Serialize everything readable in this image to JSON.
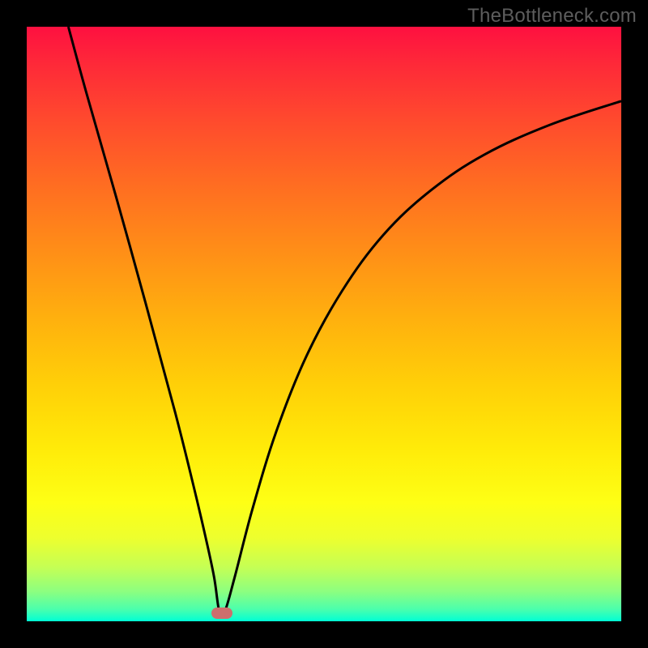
{
  "watermark": "TheBottleneck.com",
  "chart_data": {
    "type": "line",
    "title": "",
    "xlabel": "",
    "ylabel": "",
    "xlim": [
      0,
      100
    ],
    "ylim": [
      0,
      100
    ],
    "grid": false,
    "legend": false,
    "background_gradient": {
      "stops": [
        {
          "pct": 0,
          "color": "#fe1040"
        },
        {
          "pct": 6,
          "color": "#fe2839"
        },
        {
          "pct": 16,
          "color": "#ff4b2d"
        },
        {
          "pct": 27,
          "color": "#ff6e21"
        },
        {
          "pct": 38,
          "color": "#ff8f17"
        },
        {
          "pct": 49,
          "color": "#ffb00e"
        },
        {
          "pct": 60,
          "color": "#ffcf08"
        },
        {
          "pct": 71,
          "color": "#ffeb09"
        },
        {
          "pct": 80,
          "color": "#feff15"
        },
        {
          "pct": 86,
          "color": "#edff2e"
        },
        {
          "pct": 91,
          "color": "#c4ff55"
        },
        {
          "pct": 95,
          "color": "#8cff80"
        },
        {
          "pct": 98,
          "color": "#4affad"
        },
        {
          "pct": 100,
          "color": "#00ffd6"
        }
      ]
    },
    "series": [
      {
        "name": "curve",
        "color": "#000000",
        "points": [
          {
            "x": 7.0,
            "y": 100.0
          },
          {
            "x": 10.0,
            "y": 89.0
          },
          {
            "x": 15.0,
            "y": 71.5
          },
          {
            "x": 20.0,
            "y": 53.5
          },
          {
            "x": 25.0,
            "y": 35.0
          },
          {
            "x": 28.0,
            "y": 23.0
          },
          {
            "x": 30.0,
            "y": 14.5
          },
          {
            "x": 31.5,
            "y": 7.5
          },
          {
            "x": 32.4,
            "y": 1.6
          },
          {
            "x": 33.3,
            "y": 1.6
          },
          {
            "x": 35.0,
            "y": 7.5
          },
          {
            "x": 38.0,
            "y": 19.0
          },
          {
            "x": 42.0,
            "y": 32.0
          },
          {
            "x": 47.0,
            "y": 44.5
          },
          {
            "x": 53.0,
            "y": 55.5
          },
          {
            "x": 60.0,
            "y": 65.0
          },
          {
            "x": 68.0,
            "y": 72.5
          },
          {
            "x": 77.0,
            "y": 78.5
          },
          {
            "x": 88.0,
            "y": 83.5
          },
          {
            "x": 100.0,
            "y": 87.5
          }
        ]
      }
    ],
    "marker": {
      "x": 32.8,
      "y": 1.4,
      "color": "#cd6f6d"
    }
  }
}
